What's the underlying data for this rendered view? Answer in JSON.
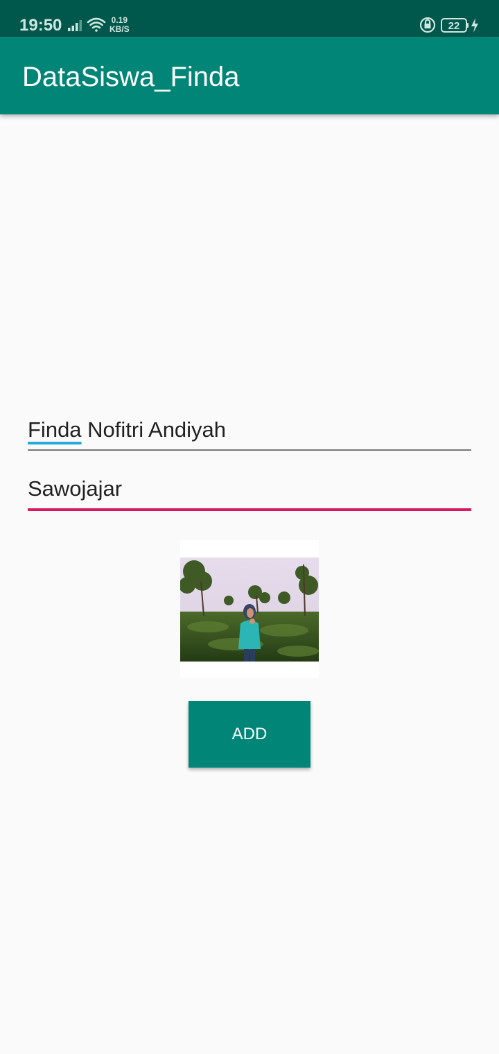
{
  "status_bar": {
    "time": "19:50",
    "net_speed_value": "0.19",
    "net_speed_unit": "KB/S",
    "battery_level": "22",
    "icons": [
      "signal-icon",
      "wifi-icon",
      "rotation-lock-icon",
      "battery-icon",
      "charging-icon"
    ]
  },
  "app_bar": {
    "title": "DataSiswa_Finda"
  },
  "form": {
    "name_first_word": "Finda",
    "name_rest": " Nofitri Andiyah",
    "address_value": "Sawojajar"
  },
  "button": {
    "add_label": "ADD"
  },
  "colors": {
    "status_bar": "#00574b",
    "primary": "#008577",
    "accent": "#d81b60",
    "spellcheck_underline": "#2aa8d8",
    "background": "#fafafa"
  }
}
